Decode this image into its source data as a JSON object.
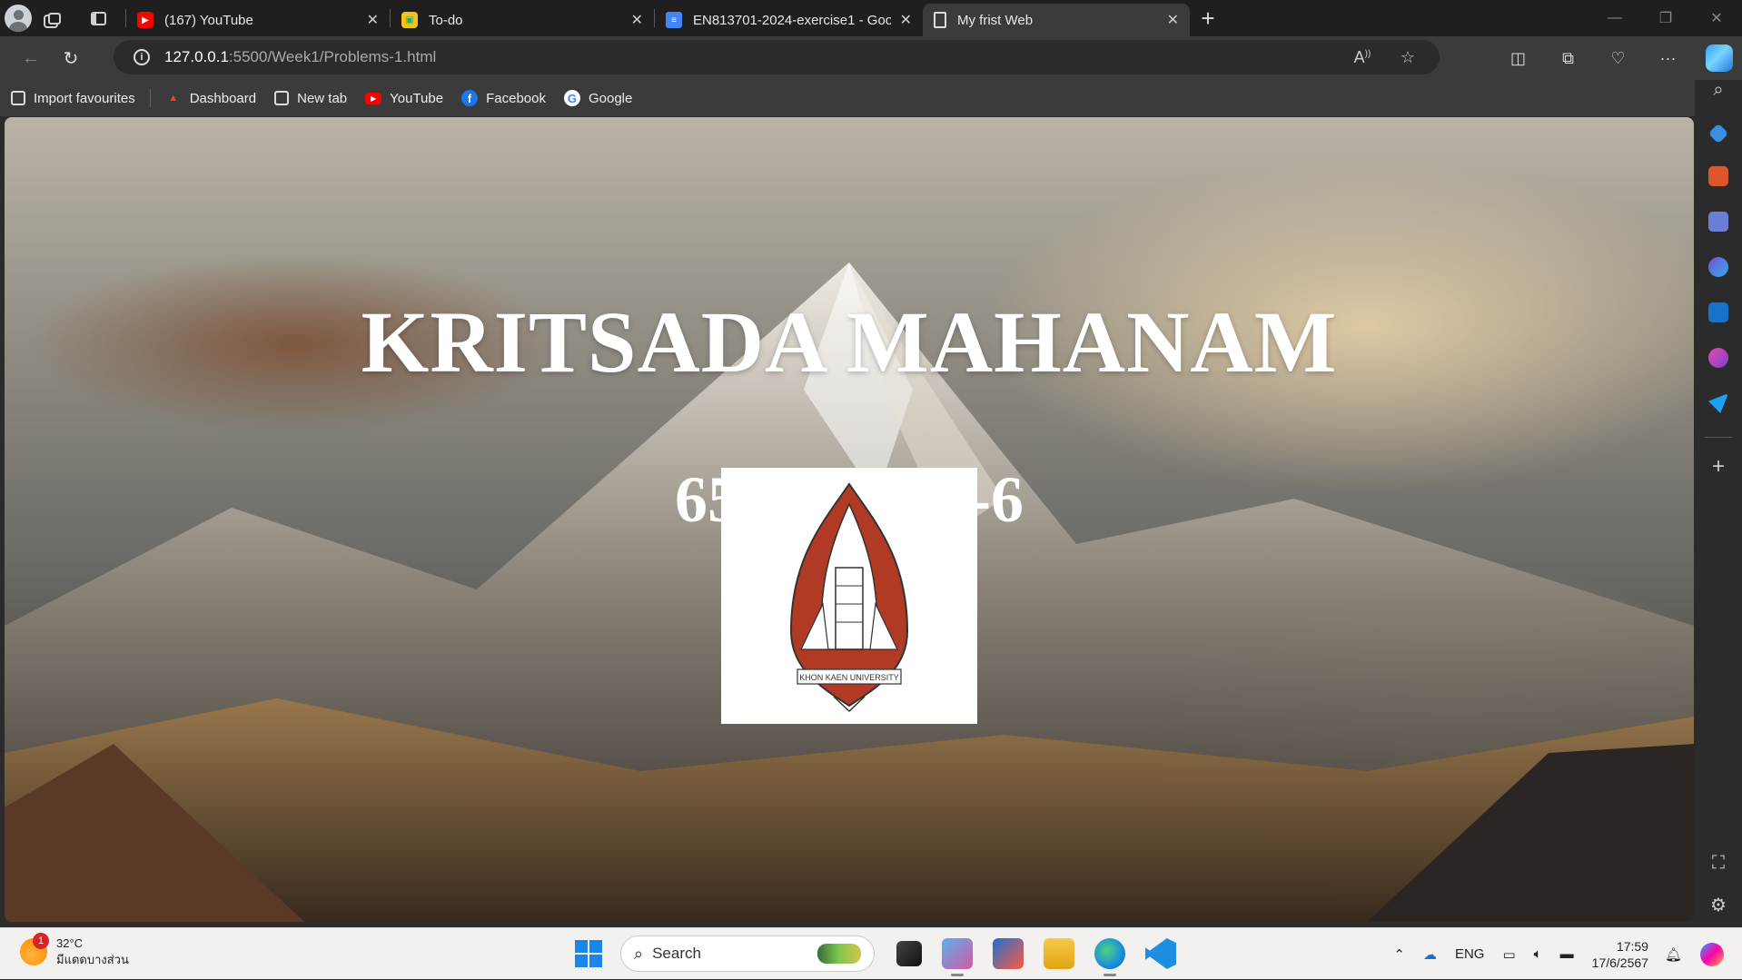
{
  "browser": {
    "tabs": [
      {
        "title": "(167) YouTube",
        "favicon": "youtube-icon",
        "active": false
      },
      {
        "title": "To-do",
        "favicon": "todo-icon",
        "active": false
      },
      {
        "title": "EN813701-2024-exercise1 - Goo",
        "favicon": "google-docs-icon",
        "active": false
      },
      {
        "title": "My frist Web",
        "favicon": "page-icon",
        "active": true
      }
    ],
    "new_tab_symbol": "+",
    "address": {
      "host": "127.0.0.1",
      "path": ":5500/Week1/Problems-1.html"
    }
  },
  "bookmarks": [
    {
      "label": "Import favourites",
      "icon": "import-icon"
    },
    {
      "label": "Dashboard",
      "icon": "dashboard-icon"
    },
    {
      "label": "New tab",
      "icon": "newtab-icon"
    },
    {
      "label": "YouTube",
      "icon": "youtube-icon"
    },
    {
      "label": "Facebook",
      "icon": "facebook-icon"
    },
    {
      "label": "Google",
      "icon": "google-icon"
    }
  ],
  "page": {
    "heading": "KRITSADA MAHANAM",
    "student_id": "653040438-6",
    "logo_caption": "KHON KAEN UNIVERSITY"
  },
  "taskbar": {
    "weather": {
      "temp": "32°C",
      "condition": "มีแดดบางส่วน",
      "badge": "1"
    },
    "search_label": "Search",
    "language": "ENG",
    "time": "17:59",
    "date": "17/6/2567"
  },
  "colors": {
    "titlebar": "#1f1f1f",
    "toolbar": "#3b3b3b",
    "taskbar": "#f2f1f0",
    "windows_blue": "#1c86e8",
    "kku_red": "#b03a24"
  }
}
